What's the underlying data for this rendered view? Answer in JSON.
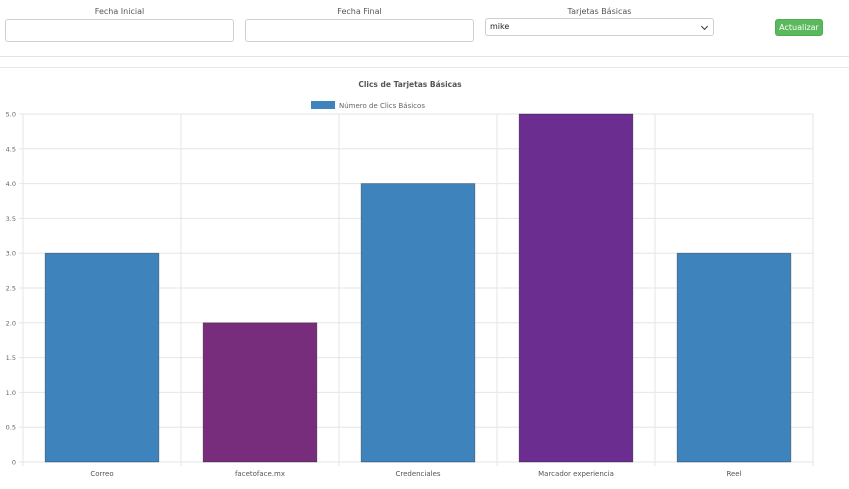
{
  "filters": {
    "fecha_inicial_label": "Fecha Inicial",
    "fecha_final_label": "Fecha Final",
    "tarjetas_label": "Tarjetas Básicas",
    "tarjetas_value": "mike",
    "update_button": "Actualizar"
  },
  "colors": {
    "blue": "#3f83bd",
    "purple": "#772d7c",
    "violet": "#6b2d8f",
    "button_green": "#5cb85c"
  },
  "chart_data": {
    "type": "bar",
    "title": "Clics de Tarjetas Básicas",
    "legend": "Número de Clics Básicos",
    "legend_position": "top-center",
    "categories": [
      "Correo",
      "facetoface.mx",
      "Credenciales",
      "Marcador experiencia",
      "Reel"
    ],
    "values": [
      3,
      2,
      4,
      5,
      3
    ],
    "bar_colors": [
      "#3f83bd",
      "#772d7c",
      "#3f83bd",
      "#6b2d8f",
      "#3f83bd"
    ],
    "ylim": [
      0,
      5
    ],
    "yticks": [
      "0",
      "0.5",
      "1.0",
      "1.5",
      "2.0",
      "2.5",
      "3.0",
      "3.5",
      "4.0",
      "4.5",
      "5.0"
    ],
    "grid": true
  }
}
